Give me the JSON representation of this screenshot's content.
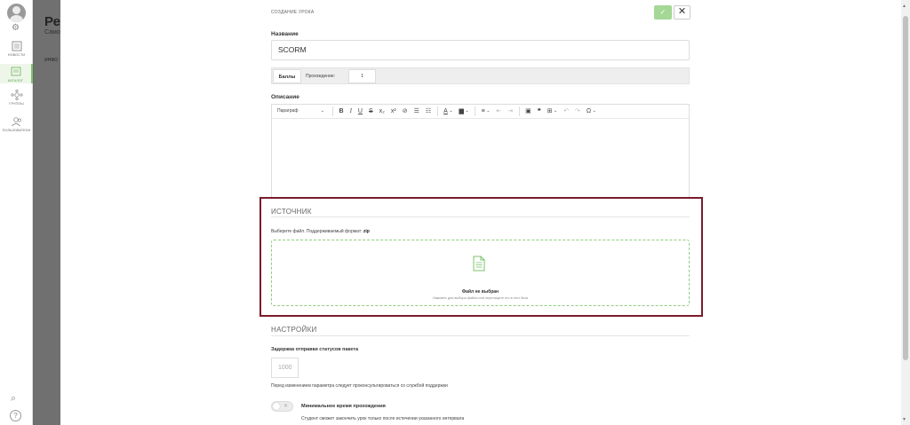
{
  "sidebar": {
    "items": [
      {
        "label": "НОВОСТИ",
        "icon": "newspaper-icon"
      },
      {
        "label": "КАТАЛОГ",
        "icon": "catalog-icon",
        "active": true
      },
      {
        "label": "ГРУППЫ",
        "icon": "groups-icon"
      },
      {
        "label": "ПОЛЬЗОВАТЕЛИ",
        "icon": "users-icon"
      }
    ],
    "accent_color": "#7cc36a"
  },
  "background_page": {
    "title": "Ред",
    "subtitle": "Само",
    "tab": "ИНФО"
  },
  "modal": {
    "header_title": "СОЗДАНИЕ УРОКА",
    "ok_icon": "check-icon",
    "close_label": "✕",
    "name_label": "Название",
    "name_value": "SCORM",
    "score_tab": "Баллы",
    "pass_label": "Прохождение:",
    "pass_value": "1",
    "description_label": "Описание",
    "toolbar": {
      "paragraph": "Параграф"
    }
  },
  "source": {
    "title": "ИСТОЧНИК",
    "hint": "Выберите файл. Поддерживаемый формат:",
    "format": "zip",
    "dropzone_title": "Файл не выбран",
    "dropzone_sub": "Нажмите для выбора файла или перетащите его в этот блок",
    "highlight_color": "#7a1b2b"
  },
  "settings": {
    "title": "НАСТРОЙКИ",
    "delay_label": "Задержка отправки статусов пакета",
    "delay_placeholder": "1000",
    "delay_note": "Перед изменением параметра следует проконсультироваться со службой поддержки",
    "min_time_label": "Минимальное время прохождения",
    "min_time_desc": "Студент сможет закончить урок только после истечении указанного интервала"
  }
}
